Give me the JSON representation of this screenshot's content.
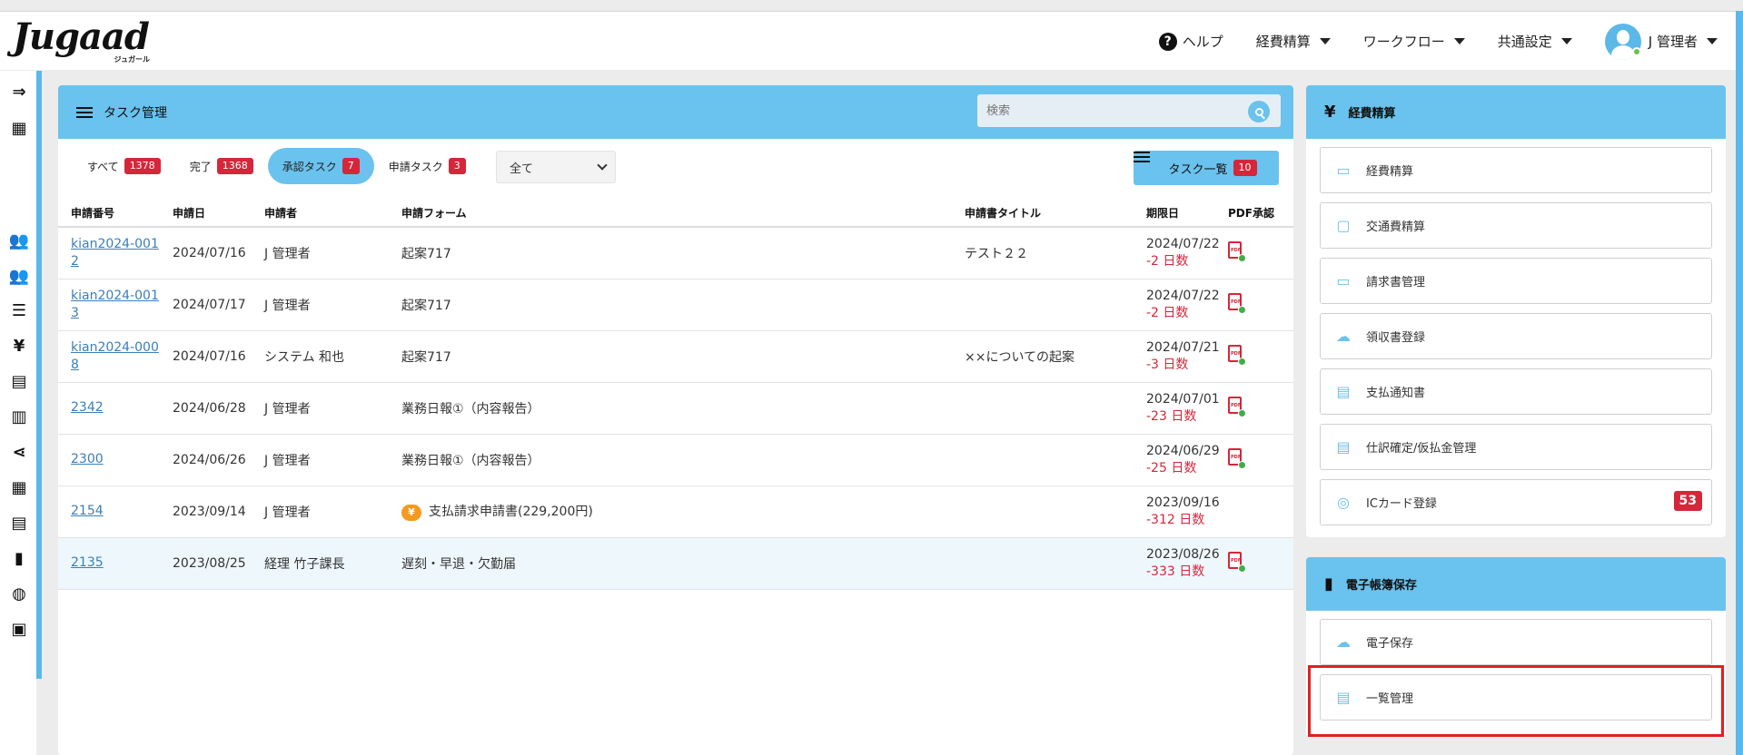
{
  "brand": {
    "logo": "Jugaad",
    "logo_sub": "ジュガール"
  },
  "nav": {
    "help": "ヘルプ",
    "expense": "経費精算",
    "workflow": "ワークフロー",
    "common": "共通設定",
    "user": "J 管理者"
  },
  "task_panel": {
    "title": "タスク管理",
    "search_placeholder": "検索",
    "tabs": [
      {
        "label": "すべて",
        "count": "1378"
      },
      {
        "label": "完了",
        "count": "1368"
      },
      {
        "label": "承認タスク",
        "count": "7"
      },
      {
        "label": "申請タスク",
        "count": "3"
      }
    ],
    "filter_value": "全て",
    "list_button": {
      "label": "タスク一覧",
      "count": "10"
    },
    "columns": [
      "申請番号",
      "申請日",
      "申請者",
      "申請フォーム",
      "申請書タイトル",
      "期限日",
      "PDF承認"
    ],
    "rows": [
      {
        "id_line1": "kian2024-001",
        "id_line2": "2",
        "date": "2024/07/16",
        "applicant": "J 管理者",
        "form": "起案717",
        "title": "テスト２２",
        "due": "2024/07/22",
        "remain": "-2 日数",
        "pdf": true
      },
      {
        "id_line1": "kian2024-001",
        "id_line2": "3",
        "date": "2024/07/17",
        "applicant": "J 管理者",
        "form": "起案717",
        "title": "",
        "due": "2024/07/22",
        "remain": "-2 日数",
        "pdf": true
      },
      {
        "id_line1": "kian2024-000",
        "id_line2": "8",
        "date": "2024/07/16",
        "applicant": "システム 和也",
        "form": "起案717",
        "title": "××についての起案",
        "due": "2024/07/21",
        "remain": "-3 日数",
        "pdf": true
      },
      {
        "id_line1": "2342",
        "id_line2": "",
        "date": "2024/06/28",
        "applicant": "J 管理者",
        "form": "業務日報①（内容報告）",
        "title": "",
        "due": "2024/07/01",
        "remain": "-23 日数",
        "pdf": true
      },
      {
        "id_line1": "2300",
        "id_line2": "",
        "date": "2024/06/26",
        "applicant": "J 管理者",
        "form": "業務日報①（内容報告）",
        "title": "",
        "due": "2024/06/29",
        "remain": "-25 日数",
        "pdf": true
      },
      {
        "id_line1": "2154",
        "id_line2": "",
        "date": "2023/09/14",
        "applicant": "J 管理者",
        "form": "支払請求申請書(229,200円)",
        "title": "",
        "due": "2023/09/16",
        "remain": "-312 日数",
        "pdf": false
      },
      {
        "id_line1": "2135",
        "id_line2": "",
        "date": "2023/08/25",
        "applicant": "経理 竹子課長",
        "form": "遅刻・早退・欠勤届",
        "title": "",
        "due": "2023/08/26",
        "remain": "-333 日数",
        "pdf": true
      }
    ]
  },
  "expense_panel": {
    "title": "経費精算",
    "items": [
      "経費精算",
      "交通費精算",
      "請求書管理",
      "領収書登録",
      "支払通知書",
      "仕訳確定/仮払金管理",
      "ICカード登録"
    ],
    "ic_badge": "53"
  },
  "ebook_panel": {
    "title": "電子帳簿保存",
    "items": [
      "電子保存",
      "一覧管理"
    ]
  }
}
